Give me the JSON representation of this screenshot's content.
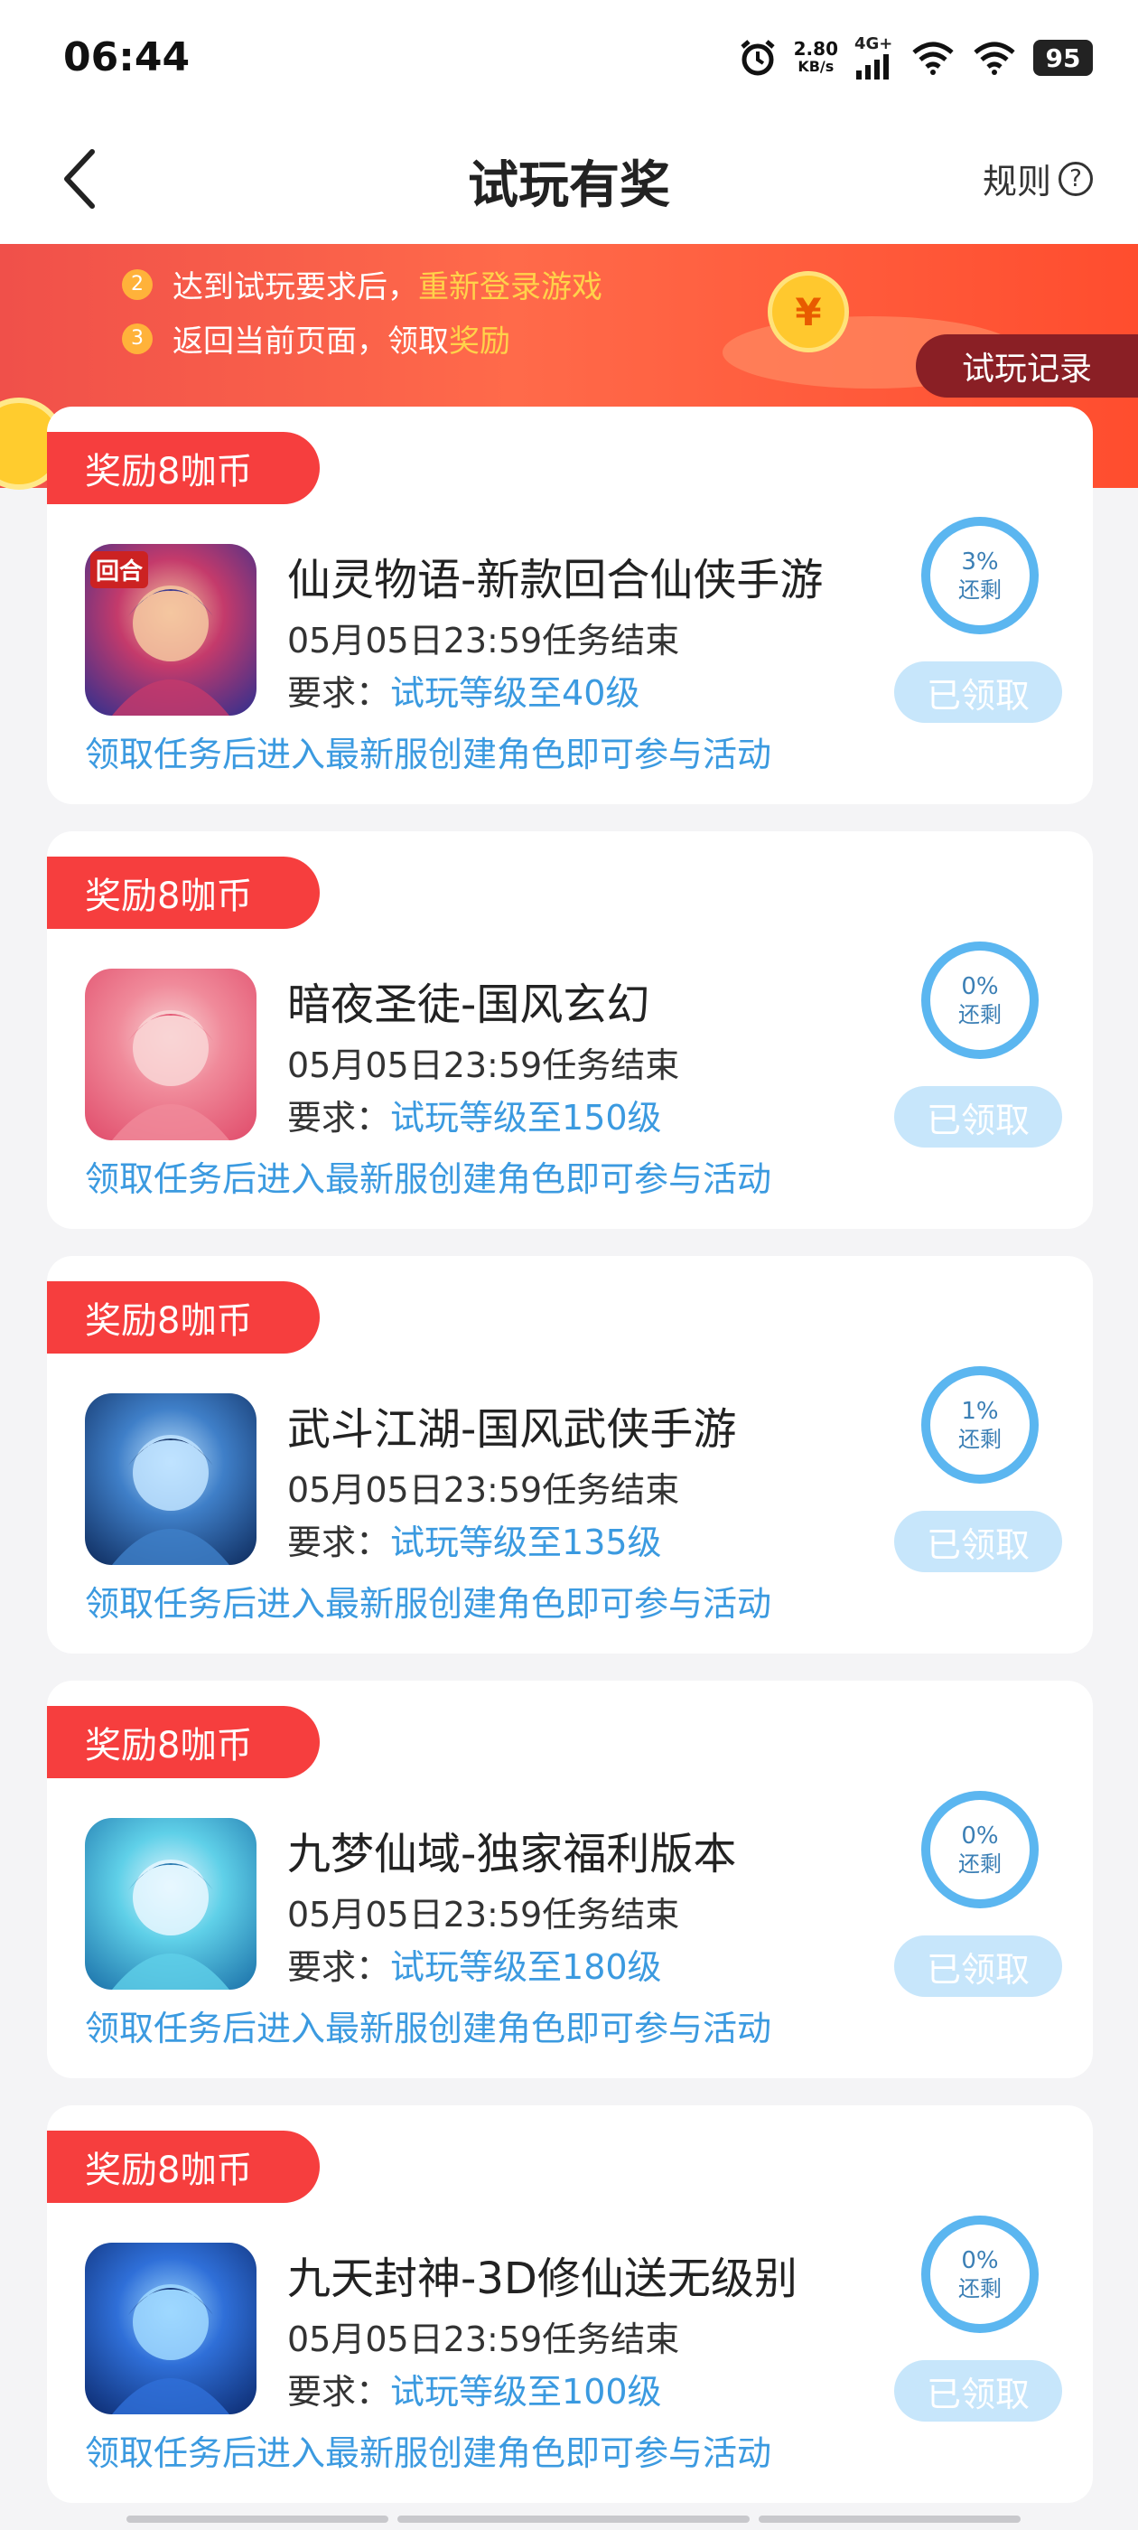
{
  "status_bar": {
    "time": "06:44",
    "net_speed_value": "2.80",
    "net_speed_unit": "KB/s",
    "network": "4G+",
    "battery": "95"
  },
  "header": {
    "title": "试玩有奖",
    "rules_label": "规则",
    "help_glyph": "?"
  },
  "banner": {
    "steps": [
      {
        "num": "2",
        "text": "达到试玩要求后，",
        "highlight": "重新登录游戏"
      },
      {
        "num": "3",
        "text": "返回当前页面，领取",
        "highlight": "奖励"
      }
    ],
    "coin_glyph": "¥",
    "record_button": "试玩记录"
  },
  "tasks": [
    {
      "reward": "奖励8咖币",
      "name": "仙灵物语-新款回合仙侠手游",
      "deadline": "05月05日23:59任务结束",
      "req_label": "要求：",
      "req_value": "试玩等级至40级",
      "note": "领取任务后进入最新服创建角色即可参与活动",
      "remaining_pct": "3%",
      "remaining_label": "还剩",
      "status": "已领取",
      "icon_badge": "回合",
      "icon_colors": [
        "#2d2f8f",
        "#c43a6b",
        "#f4c7a0"
      ]
    },
    {
      "reward": "奖励8咖币",
      "name": "暗夜圣徒-国风玄幻",
      "deadline": "05月05日23:59任务结束",
      "req_label": "要求：",
      "req_value": "试玩等级至150级",
      "note": "领取任务后进入最新服创建角色即可参与活动",
      "remaining_pct": "0%",
      "remaining_label": "还剩",
      "status": "已领取",
      "icon_badge": "",
      "icon_colors": [
        "#e04b6a",
        "#f08a9a",
        "#f9d5d5"
      ]
    },
    {
      "reward": "奖励8咖币",
      "name": "武斗江湖-国风武侠手游",
      "deadline": "05月05日23:59任务结束",
      "req_label": "要求：",
      "req_value": "试玩等级至135级",
      "note": "领取任务后进入最新服创建角色即可参与活动",
      "remaining_pct": "1%",
      "remaining_label": "还剩",
      "status": "已领取",
      "icon_badge": "",
      "icon_colors": [
        "#0d2a5c",
        "#3f7fc8",
        "#bfe3ff"
      ]
    },
    {
      "reward": "奖励8咖币",
      "name": "九梦仙域-独家福利版本",
      "deadline": "05月05日23:59任务结束",
      "req_label": "要求：",
      "req_value": "试玩等级至180级",
      "note": "领取任务后进入最新服创建角色即可参与活动",
      "remaining_pct": "0%",
      "remaining_label": "还剩",
      "status": "已领取",
      "icon_badge": "",
      "icon_colors": [
        "#1a6fa8",
        "#5fd0e8",
        "#e8f7ff"
      ]
    },
    {
      "reward": "奖励8咖币",
      "name": "九天封神-3D修仙送无级别",
      "deadline": "05月05日23:59任务结束",
      "req_label": "要求：",
      "req_value": "试玩等级至100级",
      "note": "领取任务后进入最新服创建角色即可参与活动",
      "remaining_pct": "0%",
      "remaining_label": "还剩",
      "status": "已领取",
      "icon_badge": "",
      "icon_colors": [
        "#0c2a6e",
        "#2f6fd8",
        "#9fd8ff"
      ]
    }
  ]
}
